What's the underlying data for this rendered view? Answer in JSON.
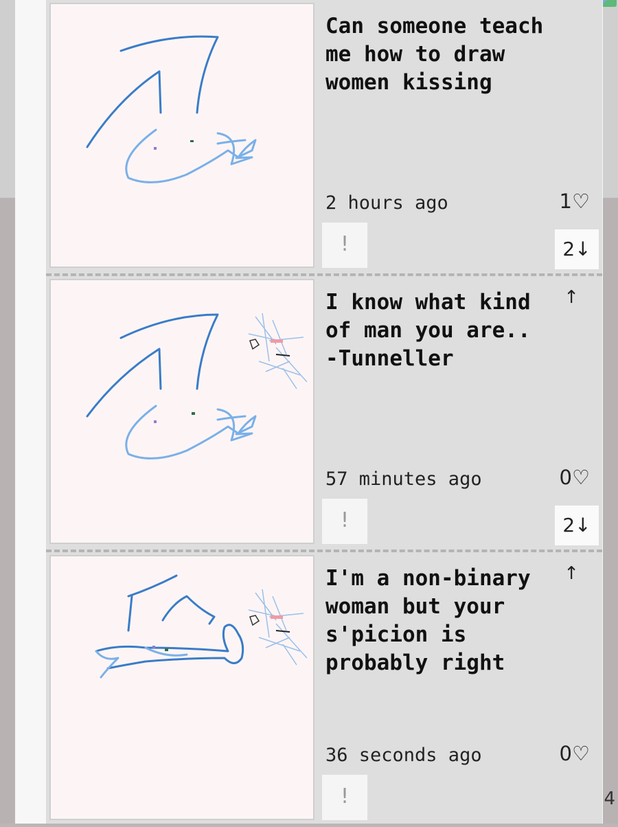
{
  "posts": [
    {
      "caption": "Can someone teach me how to draw women kissing",
      "time": "2 hours ago",
      "likes": "1♡",
      "report": "!",
      "replies": "2↓",
      "show_up_arrow": false
    },
    {
      "caption": "I know what kind of man you are.. -Tunneller",
      "time": "57 minutes ago",
      "likes": "0♡",
      "report": "!",
      "replies": "2↓",
      "up_arrow": "↑"
    },
    {
      "caption": "I'm a non-binary woman but your s'picion is probably right",
      "time": "36 seconds ago",
      "likes": "0♡",
      "report": "!",
      "up_arrow": "↑"
    }
  ],
  "page_number": "4",
  "colors": {
    "stroke_dark": "#3a7cc8",
    "stroke_light": "#7ab0e8",
    "thumb_bg": "#fdf5f5",
    "feed_bg": "#dedede"
  }
}
